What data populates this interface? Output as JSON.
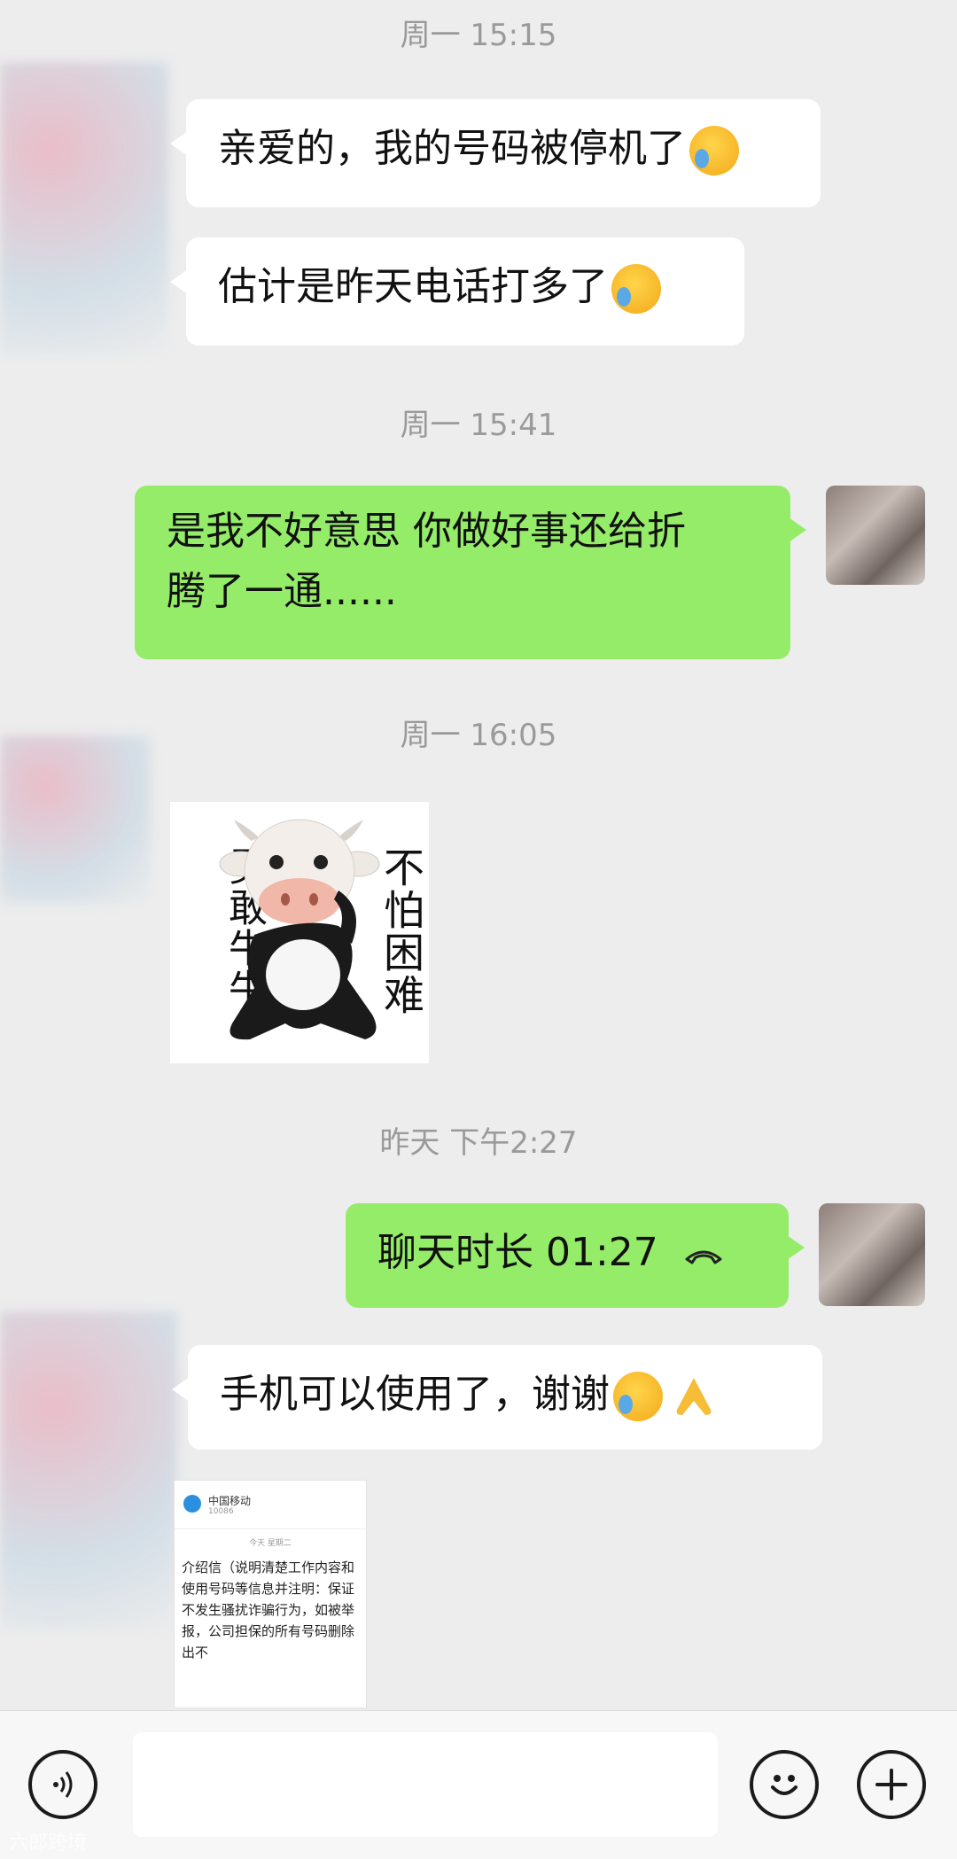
{
  "timestamps": [
    "周一 15:15",
    "周一 15:41",
    "周一 16:05",
    "昨天 下午2:27"
  ],
  "messages": {
    "m1": "亲爱的，我的号码被停机了",
    "m2": "估计是昨天电话打多了",
    "m3_line1": "是我不好意思 你做好事还给折",
    "m3_line2": "腾了一通......",
    "call": "聊天时长 01:27",
    "m5": "手机可以使用了，谢谢"
  },
  "sticker": {
    "left_text": "勇敢牛牛",
    "right_text": "不怕困难"
  },
  "screenshot_image": {
    "header_name": "中国移动",
    "header_sub": "10086",
    "small_label": "今天 星期二",
    "body_text": "介绍信（说明清楚工作内容和使用号码等信息并注明：保证不发生骚扰诈骗行为，如被举报，公司担保的所有号码删除出不"
  },
  "watermark": "六郎跨境",
  "icons": {
    "voice": "voice-icon",
    "emoji": "emoji-icon",
    "plus": "plus-icon",
    "call": "phone-hangup-icon"
  }
}
